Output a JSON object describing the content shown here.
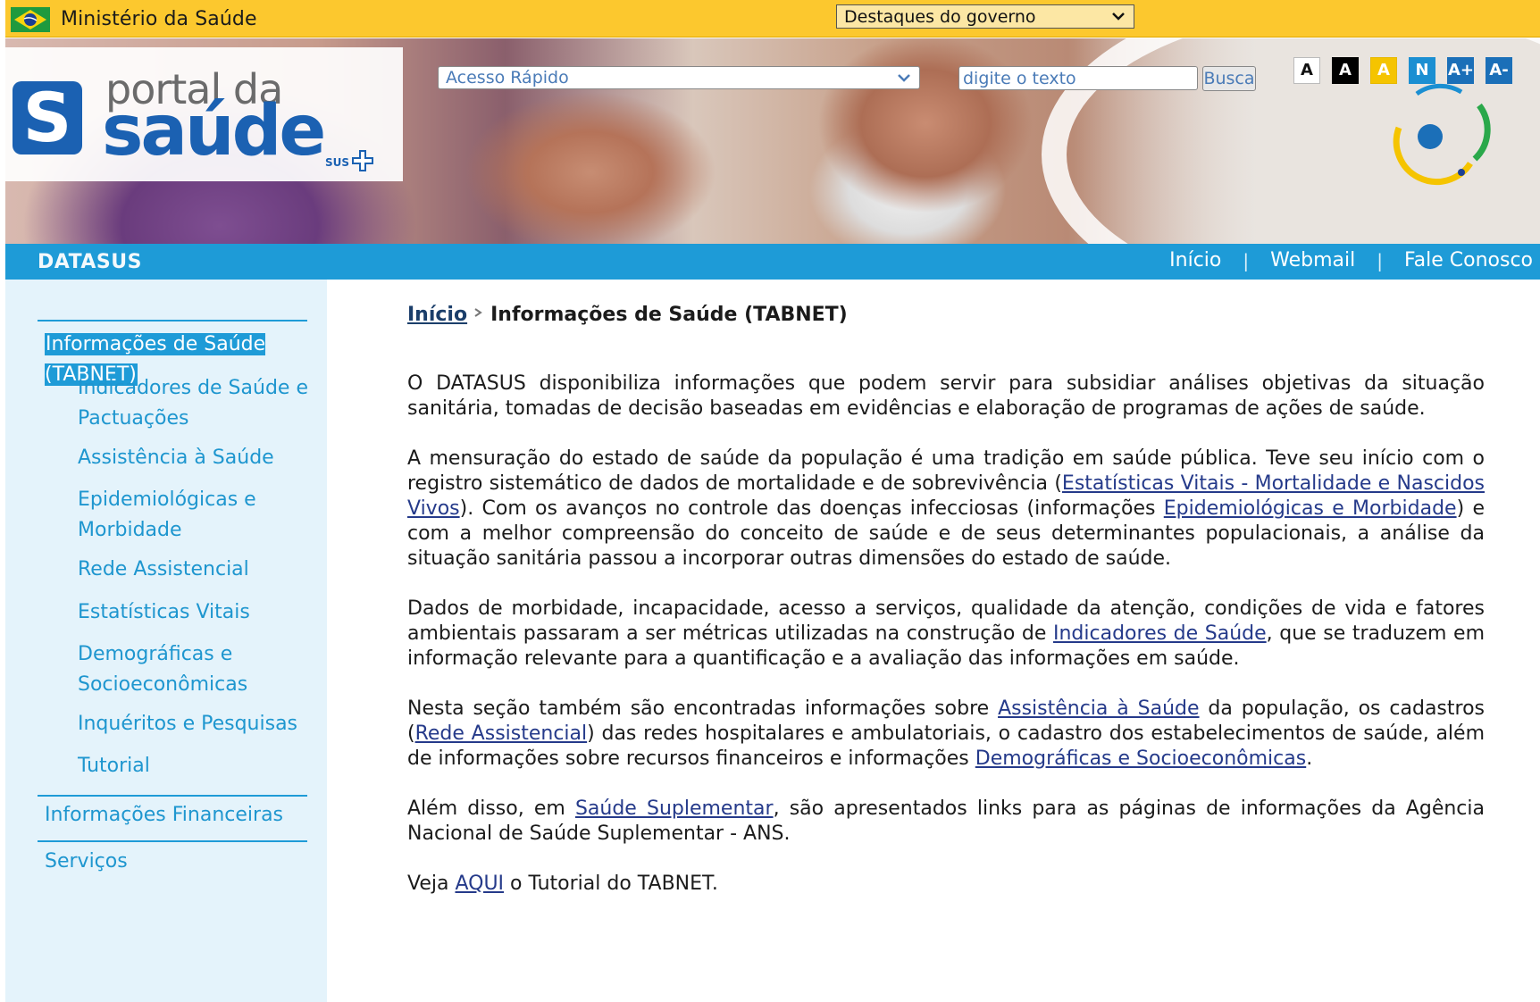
{
  "gov_bar": {
    "title": "Ministério da Saúde",
    "highlights_select": "Destaques do governo"
  },
  "header": {
    "logo_portal": "portal da",
    "logo_saude": "saúde",
    "logo_sus": "SUS",
    "logo_letter": "S",
    "quick_access": "Acesso Rápido",
    "search_placeholder": "digite o texto",
    "search_button": "Busca",
    "accessibility": [
      "A",
      "A",
      "A",
      "N",
      "A+",
      "A-"
    ]
  },
  "nav": {
    "brand": "DATASUS",
    "links": [
      "Início",
      "Webmail",
      "Fale Conosco"
    ],
    "separator": "|"
  },
  "sidebar": {
    "active": "Informações de Saúde (TABNET)",
    "sub_items": [
      "Indicadores de Saúde e Pactuações",
      "Assistência à Saúde",
      "Epidemiológicas e Morbidade",
      "Rede Assistencial",
      "Estatísticas Vitais",
      "Demográficas e Socioeconômicas",
      "Inquéritos e Pesquisas",
      "Tutorial"
    ],
    "main_items": [
      "Informações Financeiras",
      "Serviços"
    ]
  },
  "content": {
    "breadcrumb_home": "Início",
    "breadcrumb_current": "Informações de Saúde (TABNET)",
    "p1": "O DATASUS disponibiliza informações que podem servir para subsidiar  análises objetivas da situação sanitária, tomadas de decisão baseadas em evidências e elaboração de programas de ações de saúde.",
    "p2": {
      "t1": "A mensuração do estado de saúde da população é uma tradição em saúde pública. Teve seu início com o registro sistemático de dados de mortalidade e de sobrevivência (",
      "l1": "Estatísticas Vitais - Mortalidade e Nascidos Vivos",
      "t2": "). Com os avanços no controle das doenças infecciosas (informações ",
      "l2": "Epidemiológicas e Morbidade",
      "t3": ") e com a melhor compreensão do conceito de saúde e de seus determinantes populacionais, a análise da situação sanitária passou a incorporar outras dimensões do estado de saúde."
    },
    "p3": {
      "t1": "Dados de morbidade, incapacidade, acesso a serviços, qualidade da atenção, condições de vida e fatores ambientais passaram a ser métricas utilizadas na construção de ",
      "l1": "Indicadores de Saúde",
      "t2": ", que se traduzem em informação relevante para a quantificação e a avaliação das informações em saúde."
    },
    "p4": {
      "t1": "Nesta seção também são encontradas informações sobre ",
      "l1": "Assistência à Saúde",
      "t2": " da população, os cadastros (",
      "l2": "Rede Assistencial",
      "t3": ") das redes hospitalares e ambulatoriais, o cadastro dos estabelecimentos de saúde, além de informações sobre  recursos financeiros e informações ",
      "l3": "Demográficas e Socioeconômicas",
      "t4": "."
    },
    "p5": {
      "t1": "Além disso, em ",
      "l1": "Saúde Suplementar",
      "t2": ", são apresentados links para as páginas de informações da Agência Nacional de Saúde Suplementar - ANS."
    },
    "p6": {
      "t1": "Veja ",
      "l1": "AQUI",
      "t2": " o Tutorial do TABNET."
    }
  },
  "colors": {
    "gov_yellow": "#fcc82e",
    "nav_blue": "#1e9bd7",
    "sidebar_bg": "#e4f3fb",
    "link_sidebar": "#1e96cf",
    "link_content": "#253a8a",
    "logo_blue": "#1b61b2"
  },
  "icons": [
    "brazil-flag-icon",
    "chevron-down-icon",
    "sus-cross-icon",
    "accessibility-logo-icon",
    "breadcrumb-arrow-icon"
  ]
}
